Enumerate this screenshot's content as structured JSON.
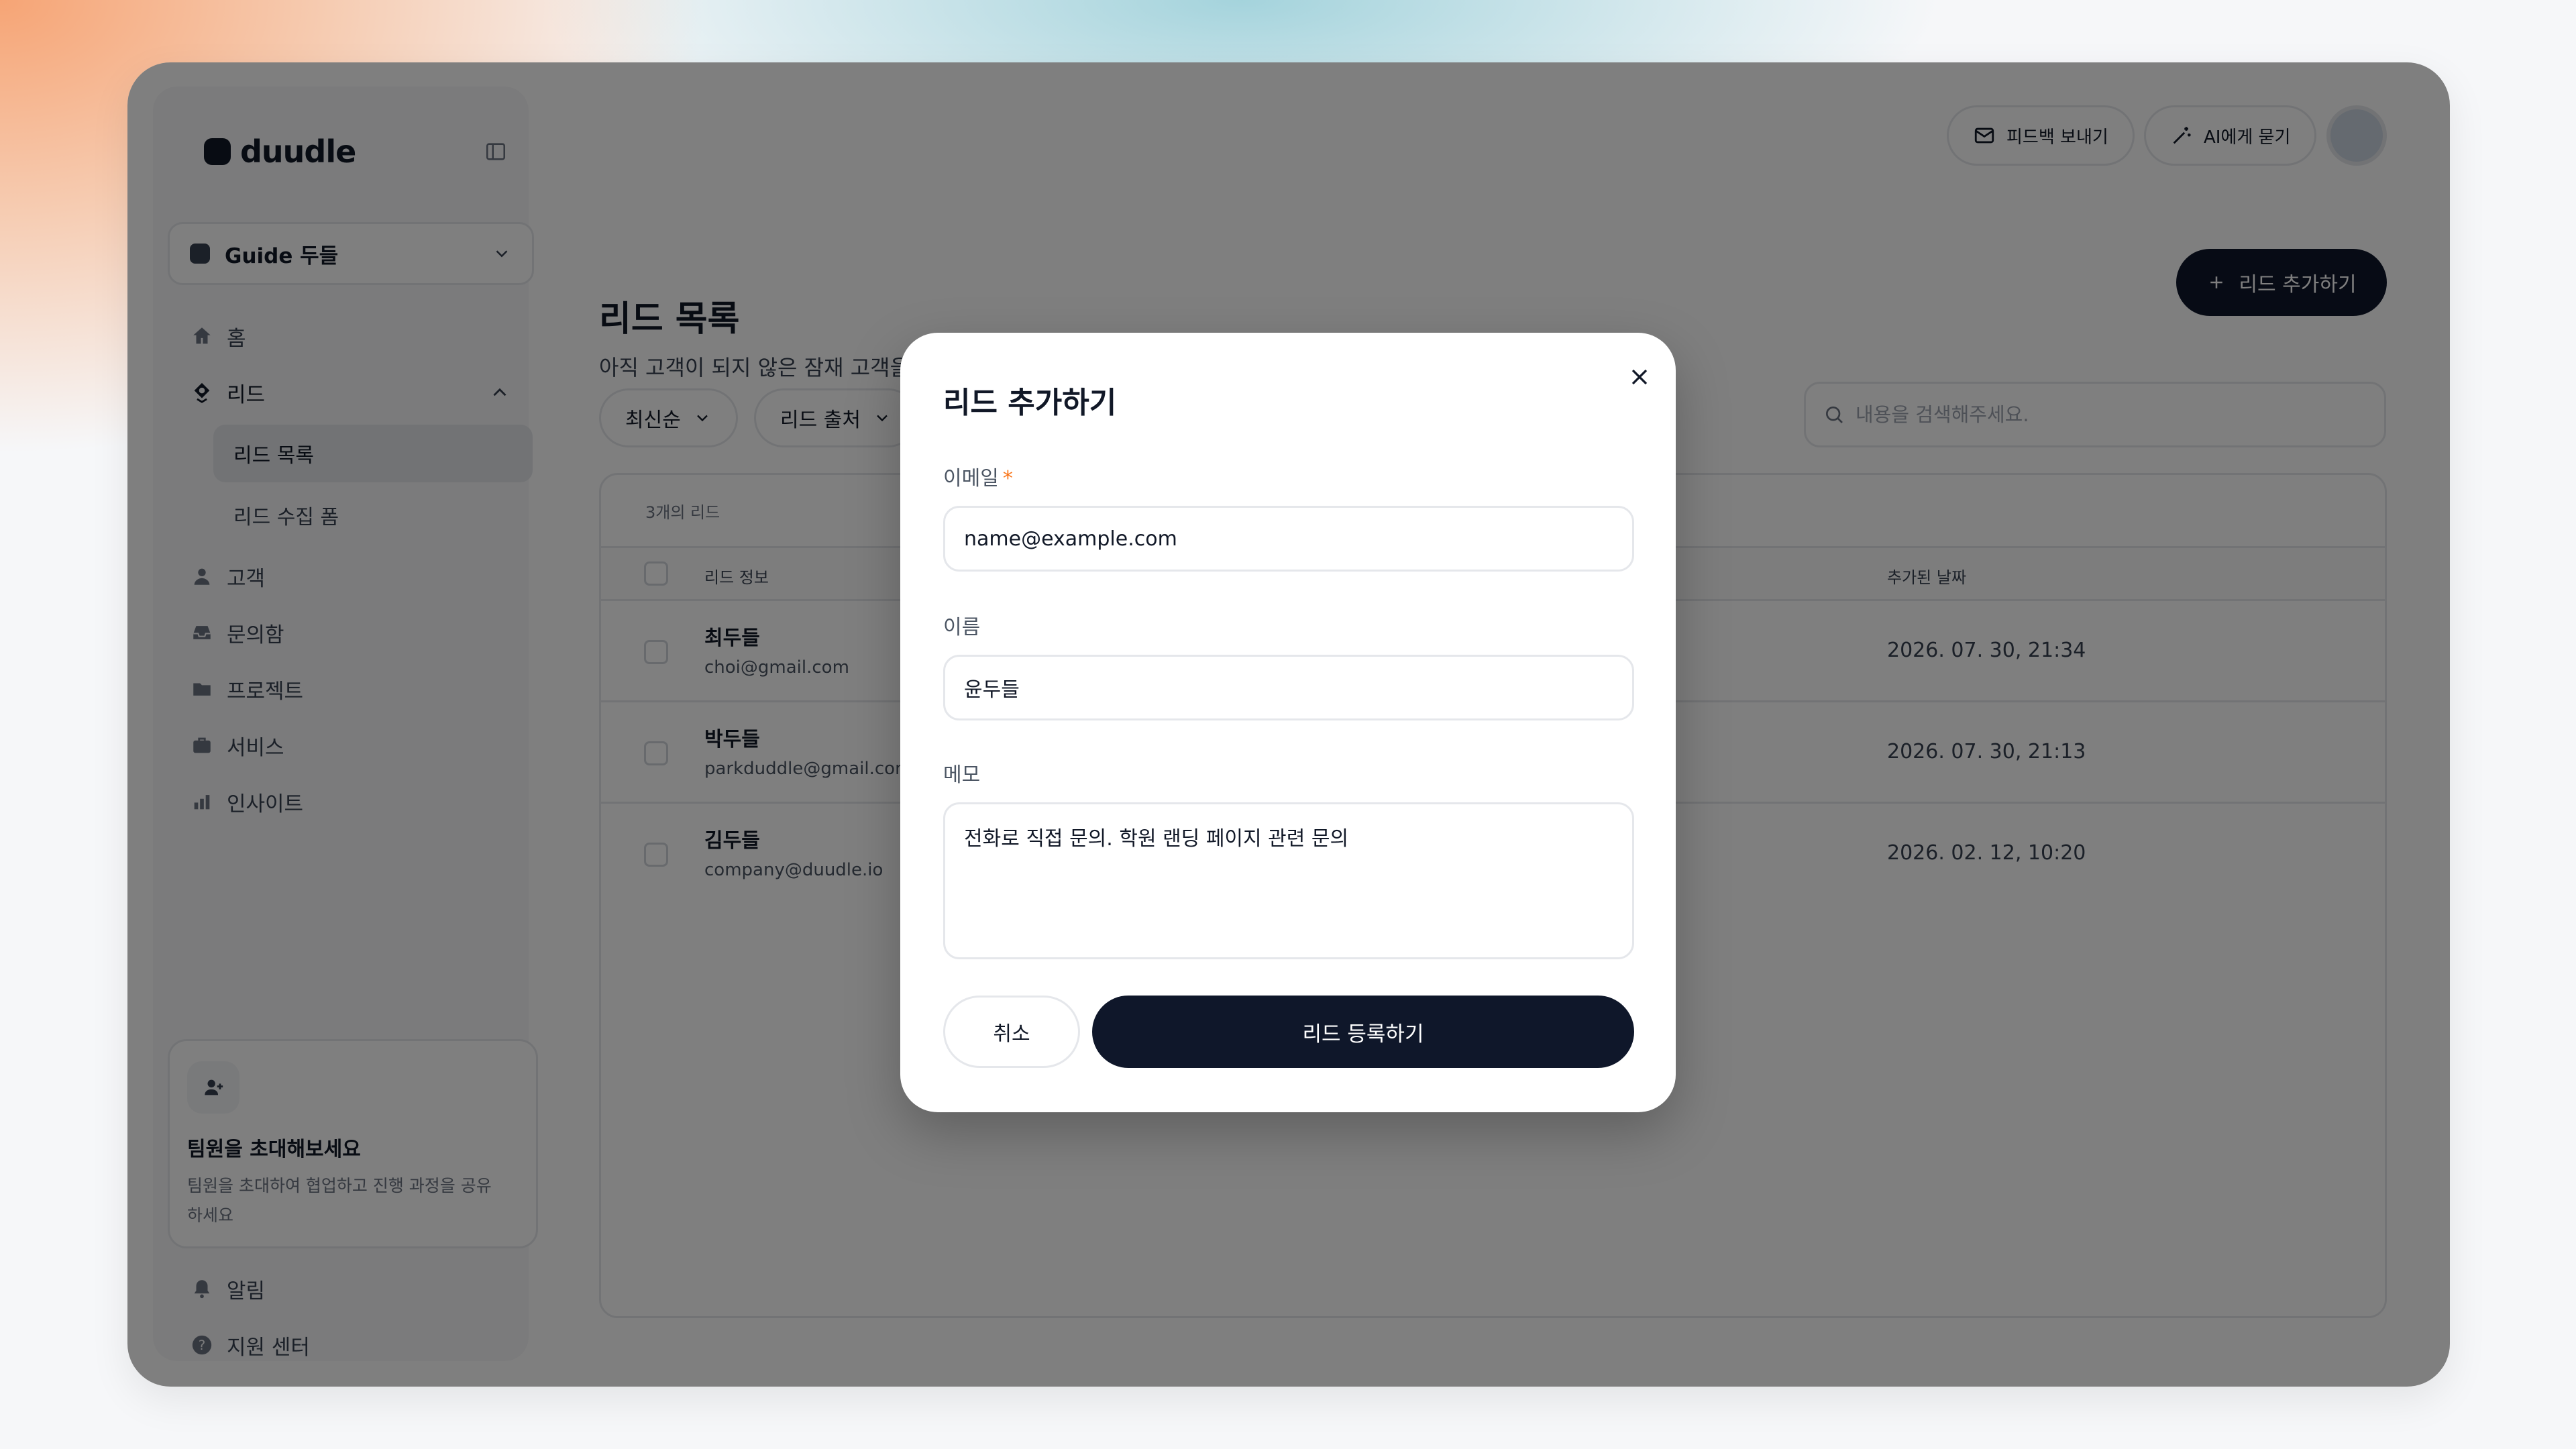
{
  "app": {
    "logo_text": "duudle",
    "workspace": "Guide 두들"
  },
  "sidebar": {
    "items": [
      {
        "label": "홈",
        "icon": "home-icon"
      },
      {
        "label": "리드",
        "icon": "lead-icon",
        "expanded": true
      },
      {
        "label": "고객",
        "icon": "person-icon"
      },
      {
        "label": "문의함",
        "icon": "inbox-icon"
      },
      {
        "label": "프로젝트",
        "icon": "folder-icon"
      },
      {
        "label": "서비스",
        "icon": "briefcase-icon"
      },
      {
        "label": "인사이트",
        "icon": "bar-chart-icon"
      }
    ],
    "sub_items": [
      {
        "label": "리드 목록",
        "active": true
      },
      {
        "label": "리드 수집 폼",
        "active": false
      }
    ],
    "invite": {
      "title": "팀원을 초대해보세요",
      "desc": "팀원을 초대하여 협업하고 진행 과정을 공유하세요"
    },
    "bottom": [
      {
        "label": "알림",
        "icon": "bell-icon"
      },
      {
        "label": "지원 센터",
        "icon": "help-icon"
      }
    ]
  },
  "topbar": {
    "feedback_label": "피드백 보내기",
    "ask_ai_label": "AI에게 묻기"
  },
  "page": {
    "title": "리드 목록",
    "subtitle": "아직 고객이 되지 않은 잠재 고객을 모아 관리해요.",
    "add_button": "리드 추가하기"
  },
  "filters": {
    "sort": "최신순",
    "source": "리드 출처",
    "search_placeholder": "내용을 검색해주세요."
  },
  "table": {
    "count": "3개의 리드",
    "headers": {
      "info": "리드 정보",
      "date": "추가된 날짜"
    },
    "rows": [
      {
        "name": "최두들",
        "email": "choi@gmail.com",
        "date": "2026. 07. 30, 21:34"
      },
      {
        "name": "박두들",
        "email": "parkduddle@gmail.com",
        "date": "2026. 07. 30, 21:13"
      },
      {
        "name": "김두들",
        "email": "company@duudle.io",
        "date": "2026. 02. 12, 10:20"
      }
    ]
  },
  "modal": {
    "title": "리드 추가하기",
    "email_label": "이메일",
    "email_required": "*",
    "email_value": "name@example.com",
    "name_label": "이름",
    "name_value": "윤두들",
    "memo_label": "메모",
    "memo_value": "전화로 직접 문의. 학원 랜딩 페이지 관련 문의",
    "cancel_label": "취소",
    "submit_label": "리드 등록하기"
  },
  "colors": {
    "primary": "#0f172a",
    "required": "#f97316",
    "sidebar_bg": "#f7f7f8"
  }
}
